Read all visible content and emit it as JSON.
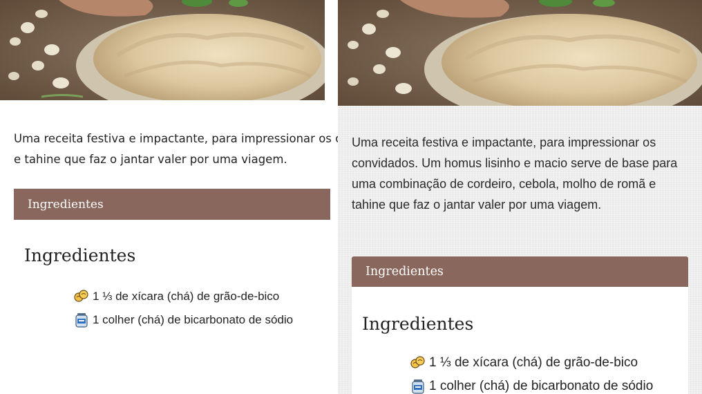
{
  "left_view": {
    "intro_line_1": "Uma receita festiva e impactante, para impressionar os c",
    "intro_line_2": "e tahine que faz o jantar valer por uma viagem.",
    "section_header": "Ingredientes",
    "ingredients_heading": "Ingredientes",
    "ingredients": [
      {
        "icon": "chickpea-icon",
        "text": "1 ⅓ de xícara (chá) de grão-de-bico"
      },
      {
        "icon": "baking-soda-jar-icon",
        "text": "1 colher (chá) de bicarbonato de sódio"
      }
    ]
  },
  "right_view": {
    "intro": "Uma receita festiva e impactante, para impressionar os convidados. Um homus lisinho e macio serve de base para uma combinação de cordeiro, cebola, molho de romã e tahine que faz o jantar valer por uma viagem.",
    "section_header": "Ingredientes",
    "ingredients_heading": "Ingredientes",
    "ingredients": [
      {
        "icon": "chickpea-icon",
        "text": "1 ⅓ de xícara (chá) de grão-de-bico"
      },
      {
        "icon": "baking-soda-jar-icon",
        "text": "1 colher (chá) de bicarbonato de sódio"
      }
    ]
  },
  "colors": {
    "section_header_bg": "#8a675d",
    "section_header_text": "#ffffff",
    "right_background": "#eeeeee"
  }
}
